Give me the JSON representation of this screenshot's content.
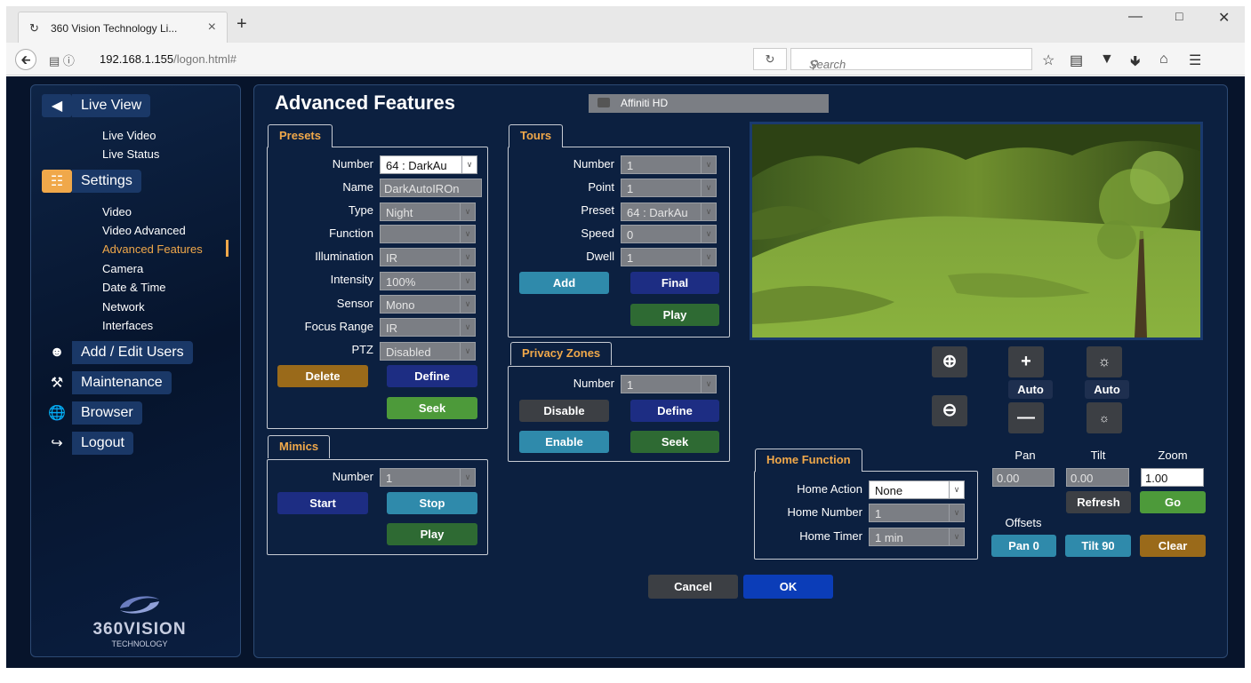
{
  "browser": {
    "tab_title": "360 Vision Technology Li...",
    "url_host": "192.168.1.155",
    "url_path": "/logon.html#",
    "search_placeholder": "Search"
  },
  "sidebar": {
    "live_view": "Live View",
    "live_items": [
      "Live Video",
      "Live Status"
    ],
    "settings": "Settings",
    "settings_items": [
      "Video",
      "Video Advanced",
      "Advanced Features",
      "Camera",
      "Date & Time",
      "Network",
      "Interfaces"
    ],
    "add_users": "Add / Edit Users",
    "maintenance": "Maintenance",
    "browser": "Browser",
    "logout": "Logout",
    "logo_main": "360VISION",
    "logo_sub": "TECHNOLOGY"
  },
  "page": {
    "title": "Advanced Features",
    "camera_name": "Affiniti HD"
  },
  "presets": {
    "tab": "Presets",
    "labels": {
      "number": "Number",
      "name": "Name",
      "type": "Type",
      "function": "Function",
      "illumination": "Illumination",
      "intensity": "Intensity",
      "sensor": "Sensor",
      "focus_range": "Focus Range",
      "ptz": "PTZ"
    },
    "values": {
      "number": "64 : DarkAu",
      "name": "DarkAutoIROn",
      "type": "Night",
      "function": "",
      "illumination": "IR",
      "intensity": "100%",
      "sensor": "Mono",
      "focus_range": "IR",
      "ptz": "Disabled"
    },
    "buttons": {
      "delete": "Delete",
      "define": "Define",
      "seek": "Seek"
    }
  },
  "tours": {
    "tab": "Tours",
    "labels": {
      "number": "Number",
      "point": "Point",
      "preset": "Preset",
      "speed": "Speed",
      "dwell": "Dwell"
    },
    "values": {
      "number": "1",
      "point": "1",
      "preset": "64 : DarkAu",
      "speed": "0",
      "dwell": "1"
    },
    "buttons": {
      "add": "Add",
      "final": "Final",
      "play": "Play"
    }
  },
  "privacy": {
    "tab": "Privacy Zones",
    "number_label": "Number",
    "number": "1",
    "buttons": {
      "disable": "Disable",
      "define": "Define",
      "enable": "Enable",
      "seek": "Seek"
    }
  },
  "mimics": {
    "tab": "Mimics",
    "number_label": "Number",
    "number": "1",
    "buttons": {
      "start": "Start",
      "stop": "Stop",
      "play": "Play"
    }
  },
  "home": {
    "tab": "Home Function",
    "labels": {
      "action": "Home Action",
      "number": "Home Number",
      "timer": "Home Timer"
    },
    "values": {
      "action": "None",
      "number": "1",
      "timer": "1 min"
    }
  },
  "ptz": {
    "auto1": "Auto",
    "auto2": "Auto",
    "pan_label": "Pan",
    "tilt_label": "Tilt",
    "zoom_label": "Zoom",
    "pan": "0.00",
    "tilt": "0.00",
    "zoom": "1.00",
    "refresh": "Refresh",
    "go": "Go",
    "offsets": "Offsets",
    "pan0": "Pan 0",
    "tilt90": "Tilt 90",
    "clear": "Clear"
  },
  "footer": {
    "cancel": "Cancel",
    "ok": "OK"
  }
}
